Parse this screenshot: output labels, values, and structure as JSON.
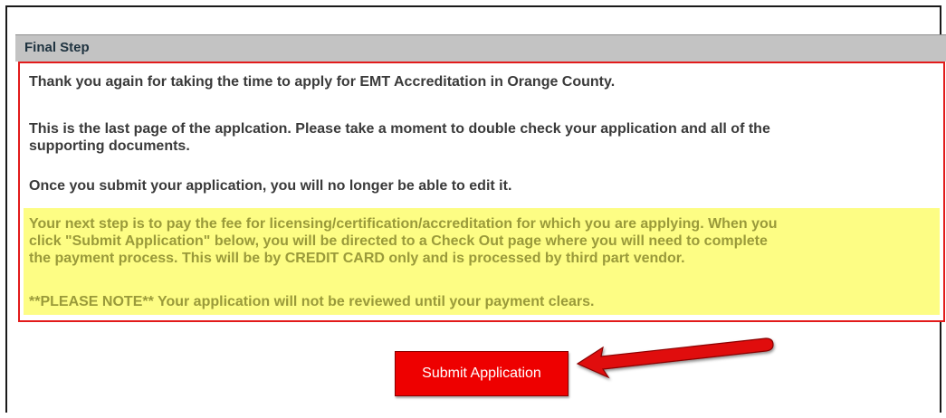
{
  "section": {
    "title": "Final Step"
  },
  "messages": {
    "thank_you": "Thank you again for taking the time to apply for EMT Accreditation in Orange County.",
    "last_page_line1": "This is the last page of the applcation.  Please take a moment to double check your application and all of the",
    "last_page_line2": "supporting documents.",
    "no_edit": "Once you submit your application, you will no longer be able to edit it."
  },
  "notice": {
    "line1": "Your next step is to pay the fee for licensing/certification/accreditation for which you are applying.  When you",
    "line2": "click \"Submit Application\" below, you will be directed to a Check Out page where you will need to complete",
    "line3": "the payment process.  This will be by CREDIT CARD only and is processed by third part vendor.",
    "please_note": "**PLEASE NOTE**  Your application will not be reviewed until your payment clears.",
    "highlight_color": "#fdfd84"
  },
  "actions": {
    "submit_label": "Submit Application",
    "submit_color": "#ee0000"
  },
  "annotation": {
    "arrow_icon": "red-arrow-pointing-left-icon",
    "arrow_color": "#e01010"
  }
}
